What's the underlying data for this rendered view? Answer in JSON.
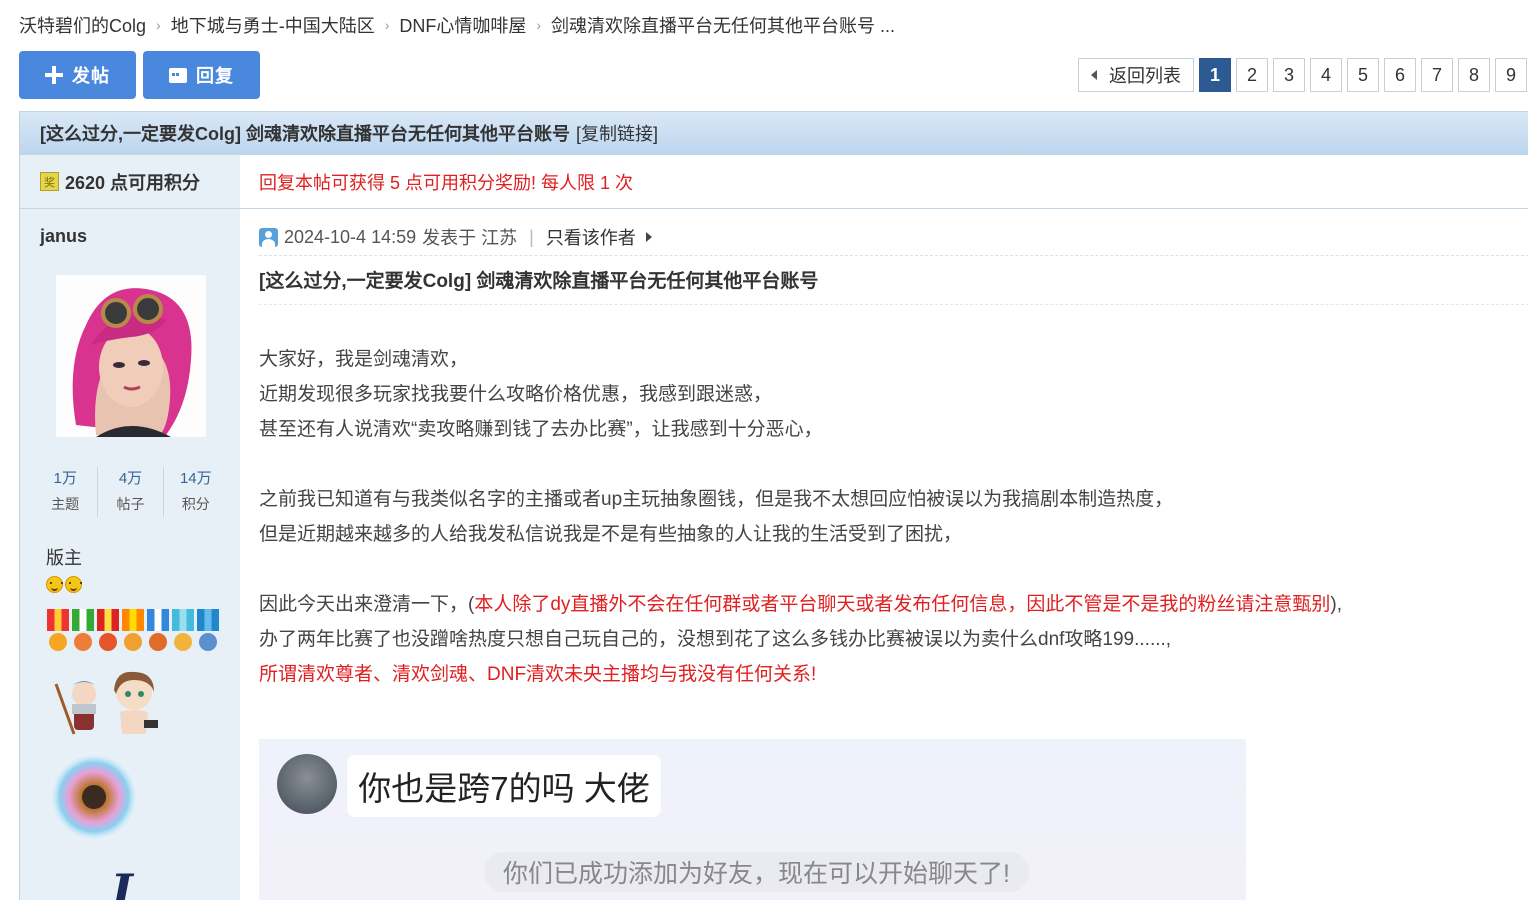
{
  "breadcrumb": {
    "items": [
      "沃特碧们的Colg",
      "地下城与勇士-中国大陆区",
      "DNF心情咖啡屋",
      "剑魂清欢除直播平台无任何其他平台账号 ..."
    ],
    "separator": "›"
  },
  "actions": {
    "post_label": "发帖",
    "reply_label": "回复"
  },
  "pager": {
    "back_label": "返回列表",
    "pages": [
      "1",
      "2",
      "3",
      "4",
      "5",
      "6",
      "7",
      "8",
      "9"
    ],
    "current": "1"
  },
  "thread": {
    "title": "[这么过分,一定要发Colg] 剑魂清欢除直播平台无任何其他平台账号",
    "copy_link": "[复制链接]",
    "credits": "2620 点可用积分",
    "award_glyph": "奖",
    "reward_notice": "回复本帖可获得 5 点可用积分奖励! 每人限 1 次"
  },
  "author": {
    "name": "janus",
    "stats": [
      {
        "num": "1万",
        "label": "主题"
      },
      {
        "num": "4万",
        "label": "帖子"
      },
      {
        "num": "14万",
        "label": "积分"
      }
    ],
    "rank": "版主",
    "signature_glyph": "J"
  },
  "post": {
    "date": "2024-10-4 14:59",
    "posted_from": "发表于 江苏",
    "only_author": "只看该作者",
    "title": "[这么过分,一定要发Colg] 剑魂清欢除直播平台无任何其他平台账号",
    "p1": "大家好，我是剑魂清欢，",
    "p2": "近期发现很多玩家找我要什么攻略价格优惠，我感到跟迷惑，",
    "p3": "甚至还有人说清欢“卖攻略赚到钱了去办比赛”，让我感到十分恶心，",
    "p4": "之前我已知道有与我类似名字的主播或者up主玩抽象圈钱，但是我不太想回应怕被误以为我搞剧本制造热度，",
    "p5": "但是近期越来越多的人给我发私信说我是不是有些抽象的人让我的生活受到了困扰，",
    "p6_prefix": "因此今天出来澄清一下，(",
    "p6_red": "本人除了dy直播外不会在任何群或者平台聊天或者发布任何信息，因此不管是不是我的粉丝请注意甄别",
    "p6_suffix": "),",
    "p7": "办了两年比赛了也没蹭啥热度只想自己玩自己的，没想到花了这么多钱办比赛被误以为卖什么dnf攻略199......,",
    "p8": "所谓清欢尊者、清欢剑魂、DNF清欢未央主播均与我没有任何关系!"
  },
  "chat": {
    "bubble": "你也是跨7的吗 大佬",
    "system": "你们已成功添加为好友，现在可以开始聊天了!"
  },
  "colors": {
    "accent": "#4a88dd",
    "link_red": "#e02020",
    "pager_current": "#2e5a94",
    "side_bg": "#e8f0f7"
  }
}
